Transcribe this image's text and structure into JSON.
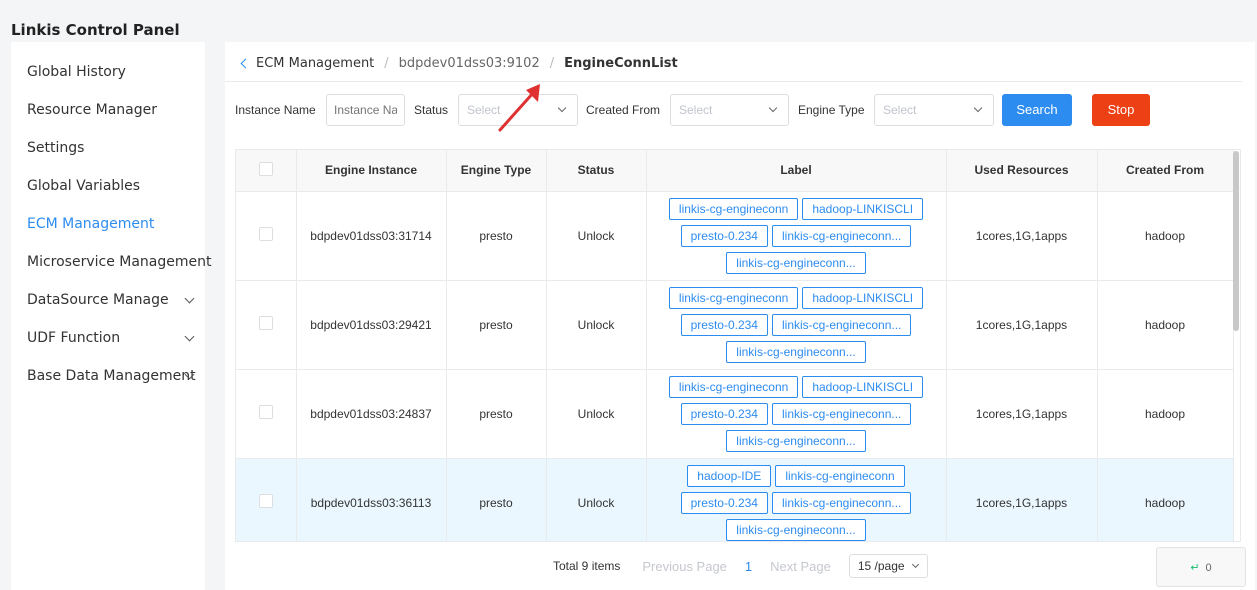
{
  "app": {
    "title": "Linkis Control Panel"
  },
  "sidebar": {
    "items": [
      {
        "label": "Global History",
        "active": false,
        "expandable": false
      },
      {
        "label": "Resource Manager",
        "active": false,
        "expandable": false
      },
      {
        "label": "Settings",
        "active": false,
        "expandable": false
      },
      {
        "label": "Global Variables",
        "active": false,
        "expandable": false
      },
      {
        "label": "ECM Management",
        "active": true,
        "expandable": false
      },
      {
        "label": "Microservice Management",
        "active": false,
        "expandable": false
      },
      {
        "label": "DataSource Manage",
        "active": false,
        "expandable": true
      },
      {
        "label": "UDF Function",
        "active": false,
        "expandable": true
      },
      {
        "label": "Base Data Management",
        "active": false,
        "expandable": true
      }
    ]
  },
  "breadcrumb": {
    "root": "ECM Management",
    "sep": "/",
    "middle": "bdpdev01dss03:9102",
    "current": "EngineConnList"
  },
  "filters": {
    "instance_label": "Instance Name",
    "instance_placeholder": "Instance Name",
    "status_label": "Status",
    "status_value": "Select",
    "created_from_label": "Created From",
    "created_from_value": "Select",
    "engine_type_label": "Engine Type",
    "engine_type_value": "Select",
    "search_label": "Search",
    "stop_label": "Stop"
  },
  "table": {
    "columns": [
      "Engine Instance",
      "Engine Type",
      "Status",
      "Label",
      "Used Resources",
      "Created From"
    ],
    "rows": [
      {
        "instance": "bdpdev01dss03:31714",
        "type": "presto",
        "status": "Unlock",
        "labels": [
          "linkis-cg-engineconn",
          "hadoop-LINKISCLI",
          "presto-0.234",
          "linkis-cg-engineconn...",
          "linkis-cg-engineconn..."
        ],
        "resources": "1cores,1G,1apps",
        "created_from": "hadoop",
        "highlighted": false
      },
      {
        "instance": "bdpdev01dss03:29421",
        "type": "presto",
        "status": "Unlock",
        "labels": [
          "linkis-cg-engineconn",
          "hadoop-LINKISCLI",
          "presto-0.234",
          "linkis-cg-engineconn...",
          "linkis-cg-engineconn..."
        ],
        "resources": "1cores,1G,1apps",
        "created_from": "hadoop",
        "highlighted": false
      },
      {
        "instance": "bdpdev01dss03:24837",
        "type": "presto",
        "status": "Unlock",
        "labels": [
          "linkis-cg-engineconn",
          "hadoop-LINKISCLI",
          "presto-0.234",
          "linkis-cg-engineconn...",
          "linkis-cg-engineconn..."
        ],
        "resources": "1cores,1G,1apps",
        "created_from": "hadoop",
        "highlighted": false
      },
      {
        "instance": "bdpdev01dss03:36113",
        "type": "presto",
        "status": "Unlock",
        "labels": [
          "hadoop-IDE",
          "linkis-cg-engineconn",
          "presto-0.234",
          "linkis-cg-engineconn...",
          "linkis-cg-engineconn..."
        ],
        "resources": "1cores,1G,1apps",
        "created_from": "hadoop",
        "highlighted": true
      }
    ]
  },
  "pagination": {
    "total": "Total 9 items",
    "prev": "Previous Page",
    "current_page": "1",
    "next": "Next Page",
    "page_size": "15 /page"
  },
  "widget": {
    "icon": "return-icon",
    "value": "0"
  },
  "colors": {
    "accent": "#2d8cf0",
    "danger": "#ed4014",
    "highlight_row": "#ebf7ff",
    "annotation_arrow": "#e03131"
  }
}
